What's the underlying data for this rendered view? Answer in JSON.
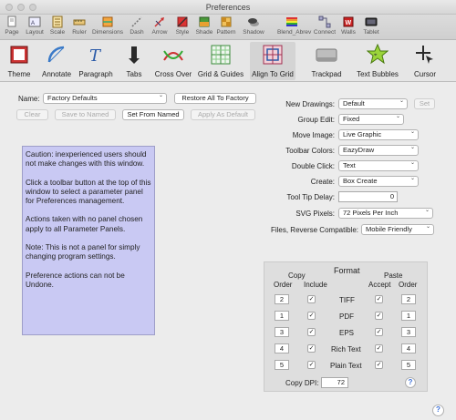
{
  "window": {
    "title": "Preferences"
  },
  "toolbar1": [
    {
      "label": "Page",
      "icon": "page-icon"
    },
    {
      "label": "Layout",
      "icon": "layout-icon"
    },
    {
      "label": "Scale",
      "icon": "scale-icon"
    },
    {
      "label": "Ruler",
      "icon": "ruler-icon"
    },
    {
      "label": "Dimensions",
      "icon": "dimensions-icon"
    },
    {
      "label": "Dash",
      "icon": "dash-icon"
    },
    {
      "label": "Arrow",
      "icon": "arrow-icon"
    },
    {
      "label": "Style",
      "icon": "style-icon"
    },
    {
      "label": "Shade",
      "icon": "shade-icon"
    },
    {
      "label": "Pattern",
      "icon": "pattern-icon"
    },
    {
      "label": "Shadow",
      "icon": "shadow-icon"
    },
    {
      "label": "Blend_Abrev",
      "icon": "blend-icon"
    },
    {
      "label": "Connect",
      "icon": "connect-icon"
    },
    {
      "label": "Walls",
      "icon": "walls-icon"
    },
    {
      "label": "Tablet",
      "icon": "tablet-icon"
    }
  ],
  "toolbar2": [
    {
      "label": "Theme",
      "icon": "theme-icon"
    },
    {
      "label": "Annotate",
      "icon": "annotate-icon"
    },
    {
      "label": "Paragraph",
      "icon": "paragraph-icon"
    },
    {
      "label": "Tabs",
      "icon": "tabs-icon"
    },
    {
      "label": "Cross Over",
      "icon": "cross-over-icon"
    },
    {
      "label": "Grid & Guides",
      "icon": "grid-guides-icon"
    },
    {
      "label": "Align To Grid",
      "icon": "align-to-grid-icon"
    },
    {
      "label": "Trackpad",
      "icon": "trackpad-icon"
    },
    {
      "label": "Text Bubbles",
      "icon": "text-bubbles-icon"
    },
    {
      "label": "Cursor",
      "icon": "cursor-icon"
    }
  ],
  "settings": {
    "name_label": "Name:",
    "name_value": "Factory Defaults",
    "restore_button": "Restore All To Factory",
    "clear_button": "Clear",
    "save_to_named_button": "Save to Named",
    "set_from_named_button": "Set From Named",
    "apply_as_default_button": "Apply As Default"
  },
  "note": {
    "p1": "Caution: inexperienced users should not make changes with this window.",
    "p2": "Click a toolbar button at the top of this window to select a parameter panel for Preferences management.",
    "p3": "Actions taken with no panel chosen apply to all Parameter Panels.",
    "p4": " Note: This is not a panel for simply changing program settings.",
    "p5": "Preference actions can not be Undone."
  },
  "right": {
    "new_drawings_label": "New Drawings:",
    "new_drawings_value": "Default",
    "set_button": "Set",
    "group_edit_label": "Group Edit:",
    "group_edit_value": "Fixed",
    "move_image_label": "Move Image:",
    "move_image_value": "Live Graphic",
    "toolbar_colors_label": "Toolbar Colors:",
    "toolbar_colors_value": "EazyDraw",
    "double_click_label": "Double Click:",
    "double_click_value": "Text",
    "create_label": "Create:",
    "create_value": "Box Create",
    "tooltip_delay_label": "Tool Tip Delay:",
    "tooltip_delay_value": "0",
    "svg_pixels_label": "SVG Pixels:",
    "svg_pixels_value": "72 Pixels Per Inch",
    "files_reverse_label": "Files, Reverse Compatible:",
    "files_reverse_value": "Mobile Friendly"
  },
  "format": {
    "title": "Format",
    "copy_header1": "Copy",
    "copy_header2_order": "Order",
    "copy_header2_include": "Include",
    "paste_header1": "Paste",
    "paste_header2_accept": "Accept",
    "paste_header2_order": "Order",
    "rows": [
      {
        "copy_order": "2",
        "include": "✓",
        "name": "TIFF",
        "accept": "✓",
        "paste_order": "2"
      },
      {
        "copy_order": "1",
        "include": "✓",
        "name": "PDF",
        "accept": "✓",
        "paste_order": "1"
      },
      {
        "copy_order": "3",
        "include": "✓",
        "name": "EPS",
        "accept": "✓",
        "paste_order": "3"
      },
      {
        "copy_order": "4",
        "include": "✓",
        "name": "Rich Text",
        "accept": "✓",
        "paste_order": "4"
      },
      {
        "copy_order": "5",
        "include": "✓",
        "name": "Plain Text",
        "accept": "✓",
        "paste_order": "5"
      }
    ],
    "copy_dpi_label": "Copy DPI:",
    "copy_dpi_value": "72"
  },
  "help": {
    "glyph": "?"
  }
}
